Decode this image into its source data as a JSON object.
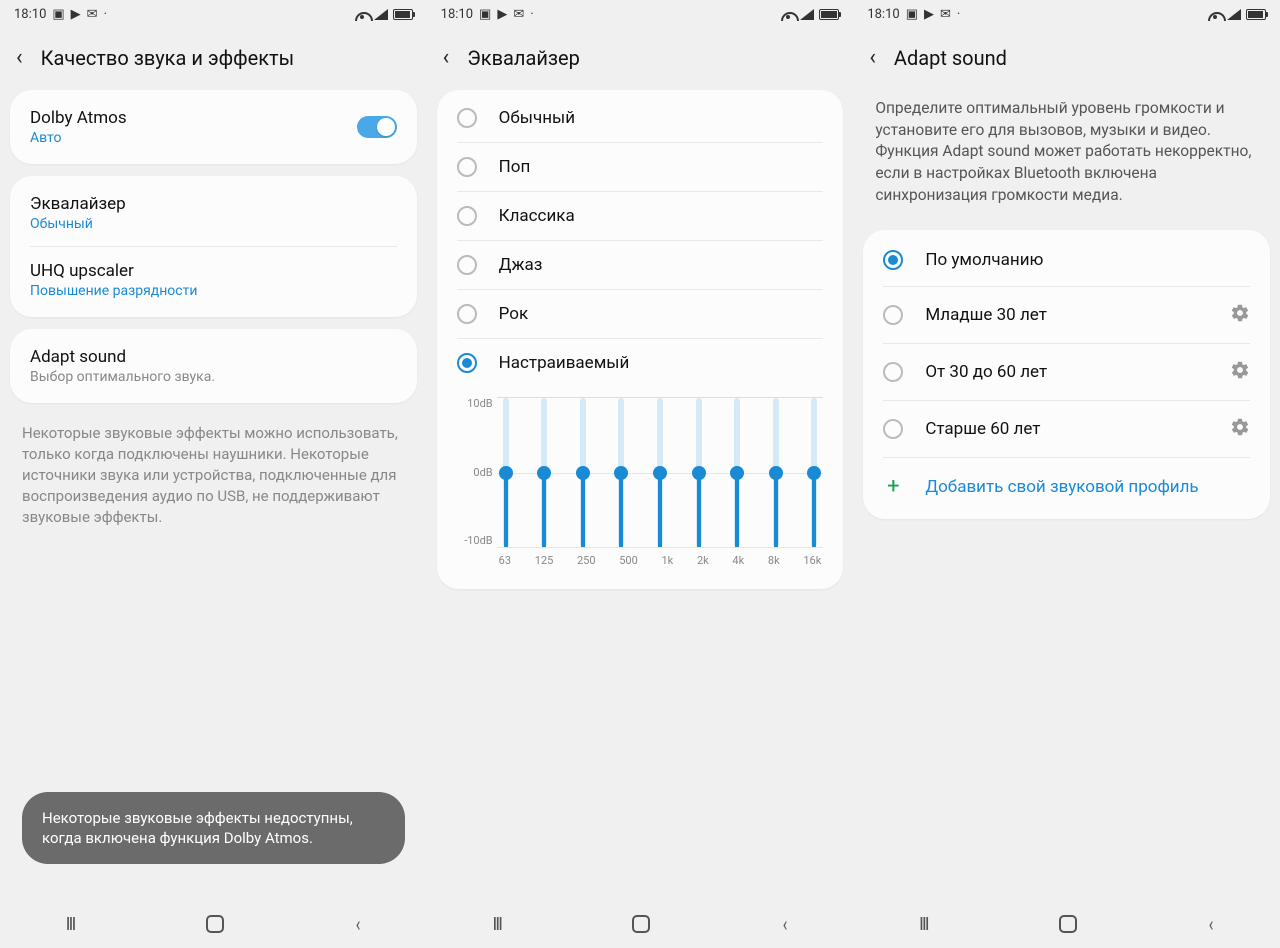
{
  "statusbar": {
    "time": "18:10"
  },
  "screen1": {
    "title": "Качество звука и эффекты",
    "dolby": {
      "title": "Dolby Atmos",
      "sub": "Авто"
    },
    "equalizer": {
      "title": "Эквалайзер",
      "sub": "Обычный"
    },
    "uhq": {
      "title": "UHQ upscaler",
      "sub": "Повышение разрядности"
    },
    "adapt": {
      "title": "Adapt sound",
      "sub": "Выбор оптимального звука."
    },
    "info": "Некоторые звуковые эффекты можно использовать, только когда подключены наушники. Некоторые источники звука или устройства, подключенные для воспроизведения аудио по USB, не поддерживают звуковые эффекты.",
    "toast": "Некоторые звуковые эффекты недоступны, когда включена функция Dolby Atmos."
  },
  "screen2": {
    "title": "Эквалайзер",
    "presets": [
      {
        "label": "Обычный",
        "checked": false
      },
      {
        "label": "Поп",
        "checked": false
      },
      {
        "label": "Классика",
        "checked": false
      },
      {
        "label": "Джаз",
        "checked": false
      },
      {
        "label": "Рок",
        "checked": false
      },
      {
        "label": "Настраиваемый",
        "checked": true
      }
    ],
    "chart_data": {
      "type": "bar",
      "categories": [
        "63",
        "125",
        "250",
        "500",
        "1k",
        "2k",
        "4k",
        "8k",
        "16k"
      ],
      "values": [
        0,
        0,
        0,
        0,
        0,
        0,
        0,
        0,
        0
      ],
      "ylabel_top": "10dB",
      "ylabel_mid": "0dB",
      "ylabel_bot": "-10dB",
      "ylim": [
        -10,
        10
      ]
    }
  },
  "screen3": {
    "title": "Adapt sound",
    "desc": "Определите оптимальный уровень громкости и установите его для вызовов, музыки и видео.\nФункция Adapt sound может работать некорректно, если в настройках Bluetooth включена синхронизация громкости медиа.",
    "options": [
      {
        "label": "По умолчанию",
        "checked": true,
        "gear": false
      },
      {
        "label": "Младше 30 лет",
        "checked": false,
        "gear": true
      },
      {
        "label": "От 30 до 60 лет",
        "checked": false,
        "gear": true
      },
      {
        "label": "Старше 60 лет",
        "checked": false,
        "gear": true
      }
    ],
    "add_label": "Добавить свой звуковой профиль"
  }
}
